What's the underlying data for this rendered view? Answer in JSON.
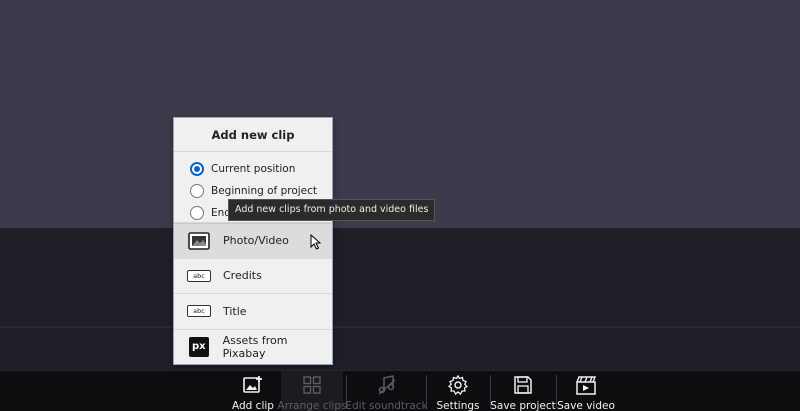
{
  "popup": {
    "title": "Add new clip",
    "radio_options": [
      {
        "label": "Current position",
        "checked": true
      },
      {
        "label": "Beginning of project",
        "checked": false
      },
      {
        "label": "End",
        "checked": false
      }
    ],
    "items": [
      {
        "label": "Photo/Video",
        "icon": "image-icon"
      },
      {
        "label": "Credits",
        "icon": "abc-icon"
      },
      {
        "label": "Title",
        "icon": "abc-icon"
      },
      {
        "label": "Assets from Pixabay",
        "icon": "pixabay-icon"
      }
    ],
    "abc_text": "abc",
    "px_text": "px"
  },
  "tooltip": {
    "text": "Add new clips from photo and video files"
  },
  "toolbar": {
    "add_clip": "Add clip",
    "arrange_clips": "Arrange clips",
    "edit_soundtrack": "Edit soundtrack",
    "settings": "Settings",
    "save_project": "Save project",
    "save_video": "Save video"
  },
  "colors": {
    "accent": "#0a63c9",
    "preview_bg": "#3b3b4b",
    "toolbar_bg": "#0d0d0f"
  }
}
